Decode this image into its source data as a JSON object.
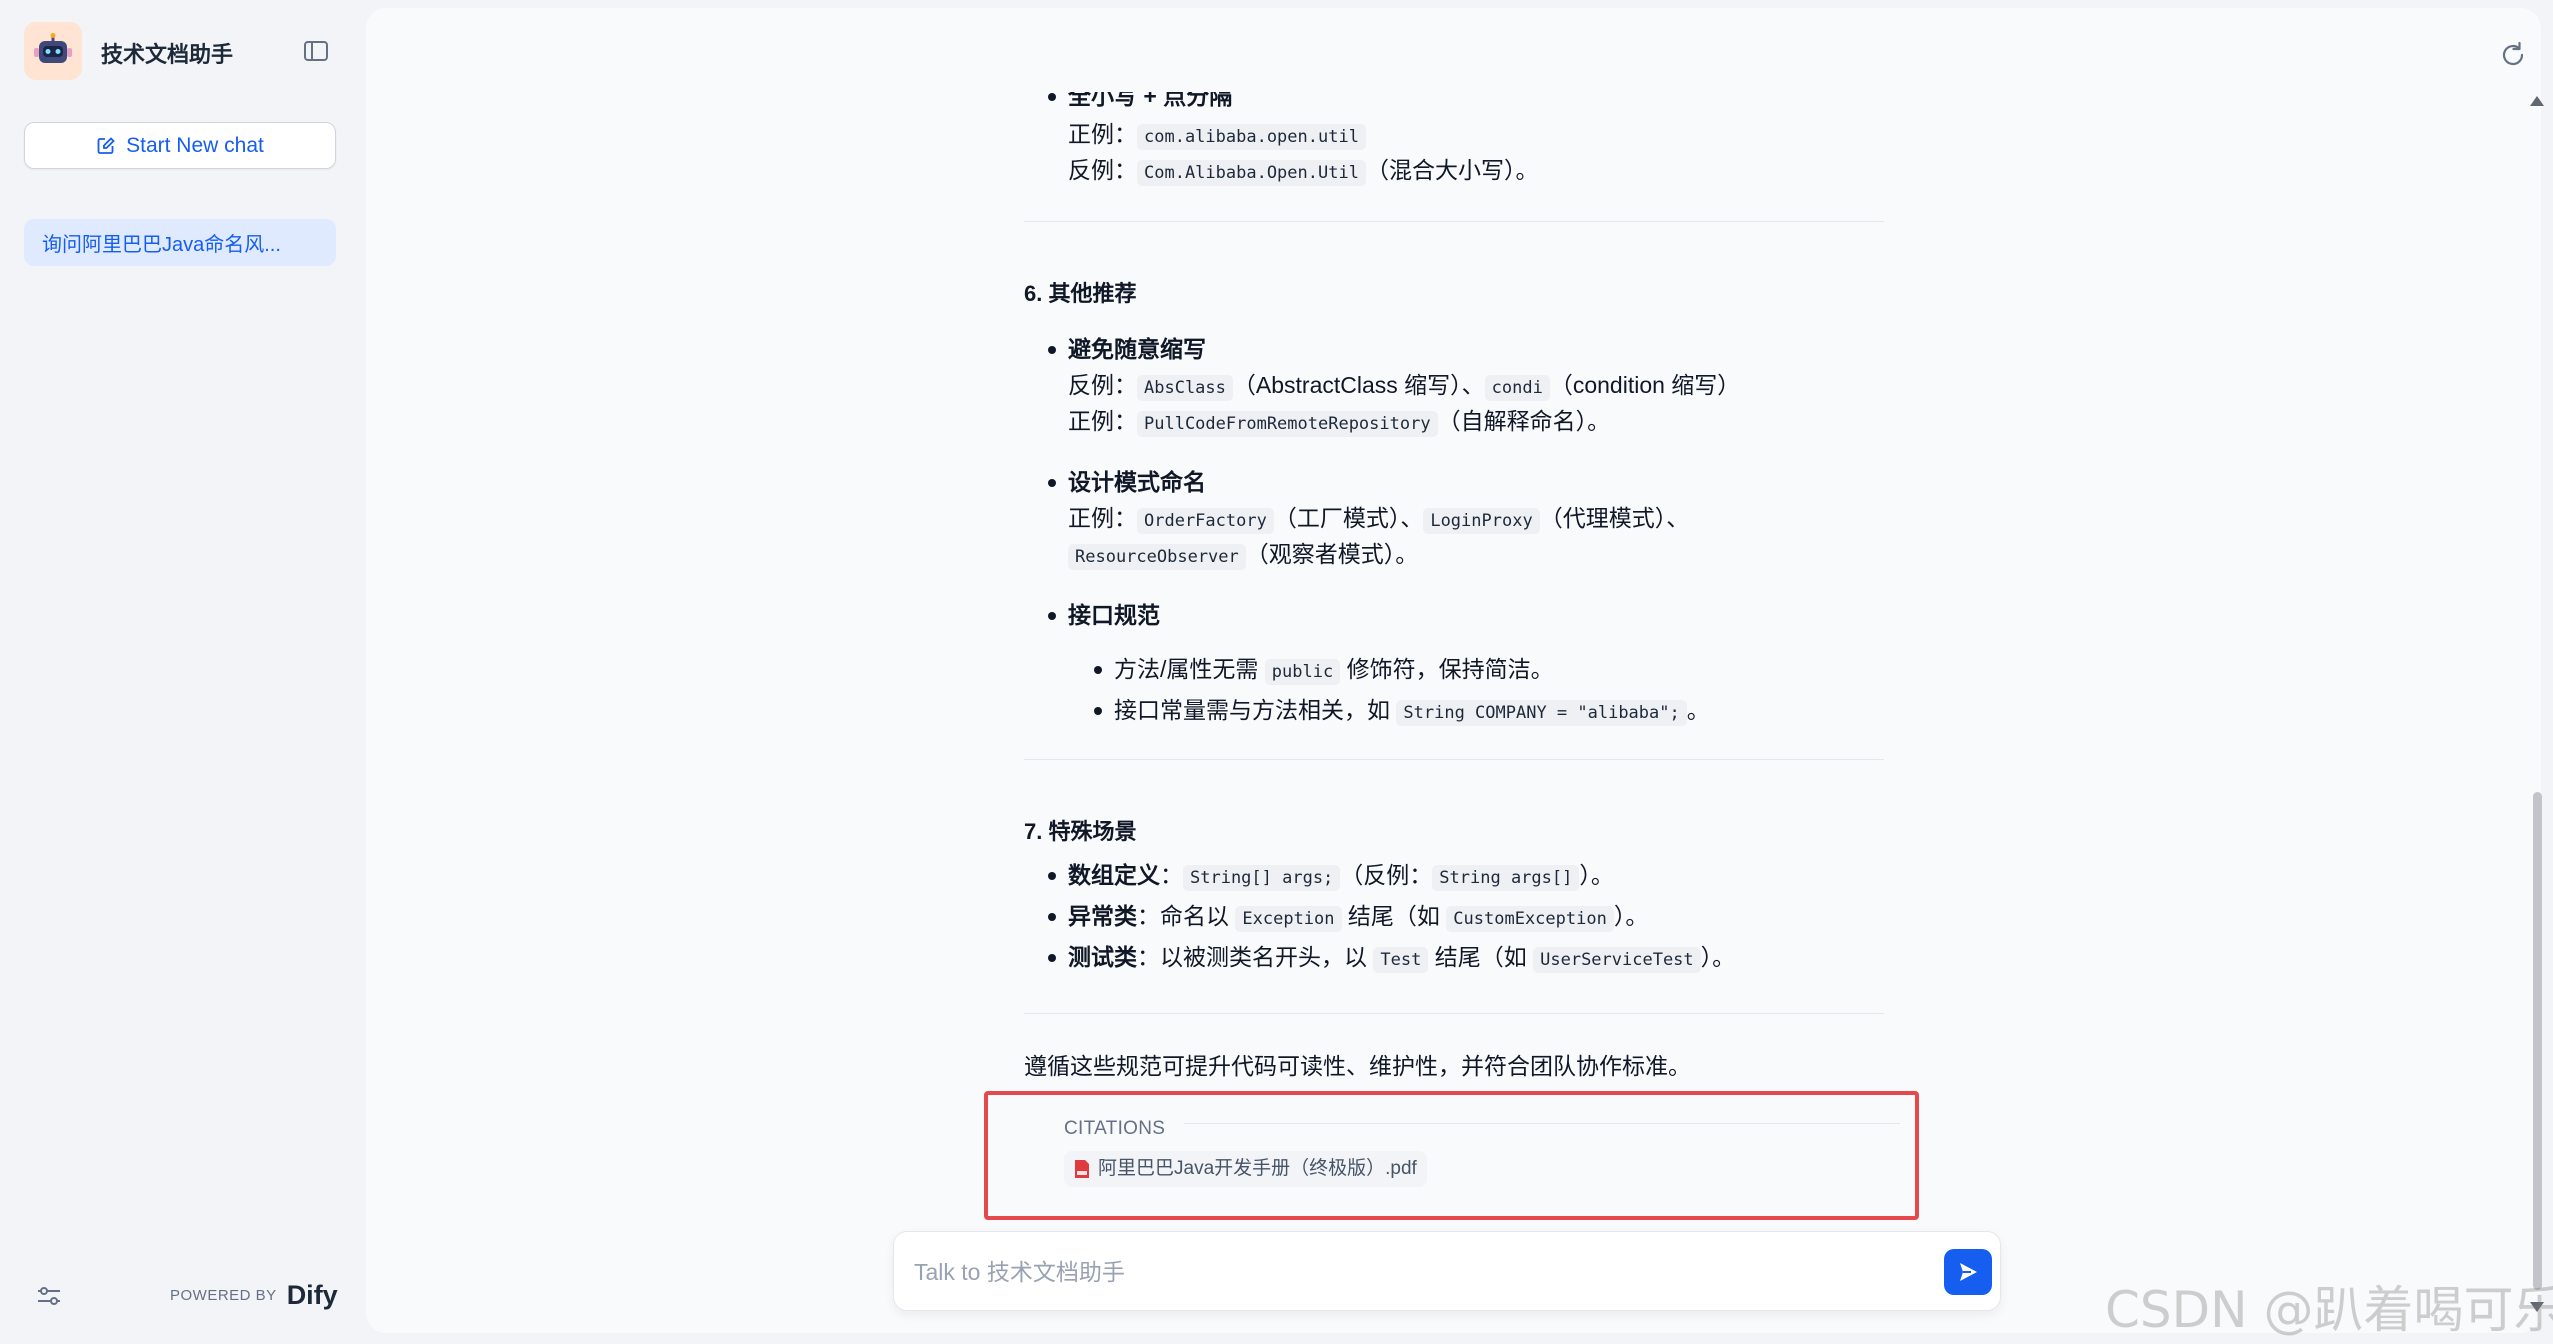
{
  "sidebar": {
    "app_title": "技术文档助手",
    "new_chat_label": "Start New chat",
    "conversations": [
      {
        "label": "询问阿里巴巴Java命名风..."
      }
    ],
    "powered_by": "POWERED BY",
    "brand": "Dify"
  },
  "answer": {
    "cut_heading": "全小写 + 点分隔",
    "pkg_good_label": "正例：",
    "pkg_good_code": "com.alibaba.open.util",
    "pkg_bad_label": "反例：",
    "pkg_bad_code": "Com.Alibaba.Open.Util",
    "pkg_bad_note": "（混合大小写）。",
    "sec6_title": "6. 其他推荐",
    "abbr_title": "避免随意缩写",
    "abbr_bad_label": "反例：",
    "abbr_code1": "AbsClass",
    "abbr_note1": "（AbstractClass 缩写）、",
    "abbr_code2": "condi",
    "abbr_note2": "（condition 缩写）",
    "abbr_good_label": "正例：",
    "abbr_code3": "PullCodeFromRemoteRepository",
    "abbr_note3": "（自解释命名）。",
    "dp_title": "设计模式命名",
    "dp_good_label": "正例：",
    "dp_code1": "OrderFactory",
    "dp_note1": "（工厂模式）、",
    "dp_code2": "LoginProxy",
    "dp_note2": "（代理模式）、",
    "dp_code3": "ResourceObserver",
    "dp_note3": "（观察者模式）。",
    "iface_title": "接口规范",
    "iface_item1_a": "方法/属性无需",
    "iface_item1_code": "public",
    "iface_item1_b": "修饰符，保持简洁。",
    "iface_item2_a": "接口常量需与方法相关，如",
    "iface_item2_code": "String COMPANY = \"alibaba\";",
    "iface_item2_b": "。",
    "sec7_title": "7. 特殊场景",
    "arr_title": "数组定义",
    "arr_colon": "：",
    "arr_code1": "String[] args;",
    "arr_note1": "（反例：",
    "arr_code2": "String args[]",
    "arr_note2": "）。",
    "exc_title": "异常类",
    "exc_a": "：命名以",
    "exc_code1": "Exception",
    "exc_b": "结尾（如",
    "exc_code2": "CustomException",
    "exc_c": "）。",
    "test_title": "测试类",
    "test_a": "：以被测类名开头，以",
    "test_code1": "Test",
    "test_b": "结尾（如",
    "test_code2": "UserServiceTest",
    "test_c": "）。",
    "conclusion": "遵循这些规范可提升代码可读性、维护性，并符合团队协作标准。"
  },
  "citations": {
    "label": "CITATIONS",
    "files": [
      {
        "name": "阿里巴巴Java开发手册（终极版）.pdf"
      }
    ]
  },
  "input": {
    "placeholder": "Talk to 技术文档助手"
  },
  "watermark": "CSDN @趴着喝可乐",
  "colors": {
    "accent": "#155eef",
    "highlight_border": "#e5484d",
    "background": "#f2f4f7"
  }
}
